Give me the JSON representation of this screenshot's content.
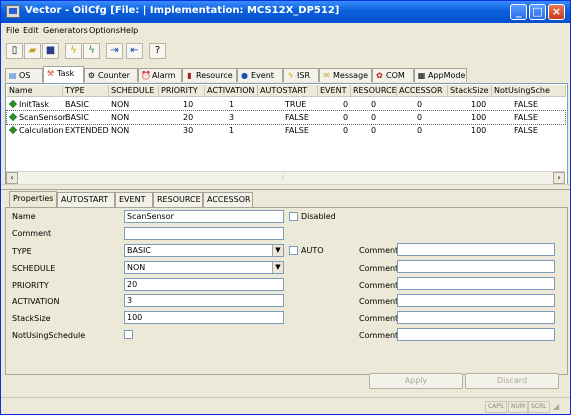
{
  "window": {
    "title": "Vector - OilCfg  [File:  | Implementation: MCS12X_DP512]"
  },
  "menu": [
    "File",
    "Edit",
    "Generators",
    "Options",
    "Help"
  ],
  "toolbar_icons": [
    "new-file-icon",
    "open-folder-icon",
    "save-icon",
    "generate-icon",
    "generate-all-icon",
    "import-icon",
    "export-icon",
    "help-icon"
  ],
  "object_tabs": [
    {
      "label": "OS",
      "icon": "os-icon"
    },
    {
      "label": "Task",
      "icon": "task-icon",
      "active": true
    },
    {
      "label": "Counter",
      "icon": "counter-icon"
    },
    {
      "label": "Alarm",
      "icon": "alarm-icon"
    },
    {
      "label": "Resource",
      "icon": "resource-icon"
    },
    {
      "label": "Event",
      "icon": "event-icon"
    },
    {
      "label": "ISR",
      "icon": "isr-icon"
    },
    {
      "label": "Message",
      "icon": "message-icon"
    },
    {
      "label": "COM",
      "icon": "com-icon"
    },
    {
      "label": "AppMode",
      "icon": "appmode-icon"
    }
  ],
  "table": {
    "columns": [
      "Name",
      "TYPE",
      "SCHEDULE",
      "PRIORITY",
      "ACTIVATION",
      "AUTOSTART",
      "EVENT",
      "RESOURCE",
      "ACCESSOR",
      "StackSize",
      "NotUsingSche"
    ],
    "rows": [
      [
        "InitTask",
        "BASIC",
        "NON",
        "10",
        "1",
        "TRUE",
        "0",
        "0",
        "0",
        "100",
        "FALSE"
      ],
      [
        "ScanSensor",
        "BASIC",
        "NON",
        "20",
        "3",
        "FALSE",
        "0",
        "0",
        "0",
        "100",
        "FALSE"
      ],
      [
        "Calculation",
        "EXTENDED",
        "NON",
        "30",
        "1",
        "FALSE",
        "0",
        "0",
        "0",
        "100",
        "FALSE"
      ]
    ],
    "selected_row": 1
  },
  "detail_tabs": [
    "Properties",
    "AUTOSTART",
    "EVENT",
    "RESOURCE",
    "ACCESSOR"
  ],
  "properties": {
    "name_label": "Name",
    "name_value": "ScanSensor",
    "disabled_label": "Disabled",
    "comment_label": "Comment",
    "comment_value": "",
    "type_label": "TYPE",
    "type_value": "BASIC",
    "auto_label": "AUTO",
    "schedule_label": "SCHEDULE",
    "schedule_value": "NON",
    "priority_label": "PRIORITY",
    "priority_value": "20",
    "activation_label": "ACTIVATION",
    "activation_value": "3",
    "stacksize_label": "StackSize",
    "stacksize_value": "100",
    "notusing_label": "NotUsingSchedule",
    "right_comment_label": "Comment"
  },
  "buttons": {
    "apply": "Apply",
    "discard": "Discard"
  },
  "status": [
    "CAPS",
    "NUM",
    "SCRL"
  ],
  "colors": {
    "title_bar": "#0a5fd8",
    "accent_green": "#2e8b2e",
    "window_bg": "#ece9d8"
  }
}
